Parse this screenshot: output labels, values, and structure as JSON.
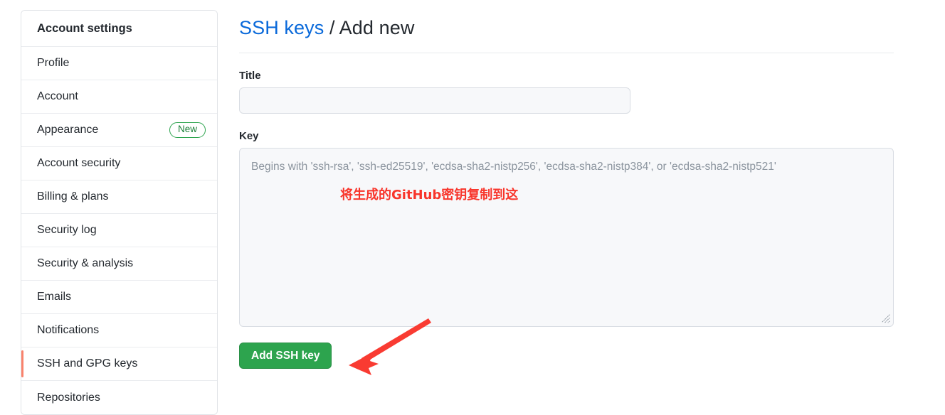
{
  "sidebar": {
    "header": "Account settings",
    "items": [
      {
        "label": "Profile",
        "badge": null,
        "selected": false
      },
      {
        "label": "Account",
        "badge": null,
        "selected": false
      },
      {
        "label": "Appearance",
        "badge": "New",
        "selected": false
      },
      {
        "label": "Account security",
        "badge": null,
        "selected": false
      },
      {
        "label": "Billing & plans",
        "badge": null,
        "selected": false
      },
      {
        "label": "Security log",
        "badge": null,
        "selected": false
      },
      {
        "label": "Security & analysis",
        "badge": null,
        "selected": false
      },
      {
        "label": "Emails",
        "badge": null,
        "selected": false
      },
      {
        "label": "Notifications",
        "badge": null,
        "selected": false
      },
      {
        "label": "SSH and GPG keys",
        "badge": null,
        "selected": true
      },
      {
        "label": "Repositories",
        "badge": null,
        "selected": false
      }
    ]
  },
  "main": {
    "title_link": "SSH keys",
    "title_separator": " / ",
    "title_tail": "Add new",
    "title_field": {
      "label": "Title",
      "value": "",
      "placeholder": ""
    },
    "key_field": {
      "label": "Key",
      "value": "",
      "placeholder": "Begins with 'ssh-rsa', 'ssh-ed25519', 'ecdsa-sha2-nistp256', 'ecdsa-sha2-nistp384', or 'ecdsa-sha2-nistp521'"
    },
    "submit_label": "Add SSH key"
  },
  "annotations": {
    "note_text": "将生成的GitHub密钥复制到这",
    "note_color": "#f8352b",
    "arrow_color": "#f93b32"
  },
  "colors": {
    "link": "#0969da",
    "accent_selected": "#f9826c",
    "badge_green": "#2da44e",
    "button_green": "#2da44e",
    "field_bg": "#f7f8fa",
    "field_border": "#d9dde3"
  }
}
